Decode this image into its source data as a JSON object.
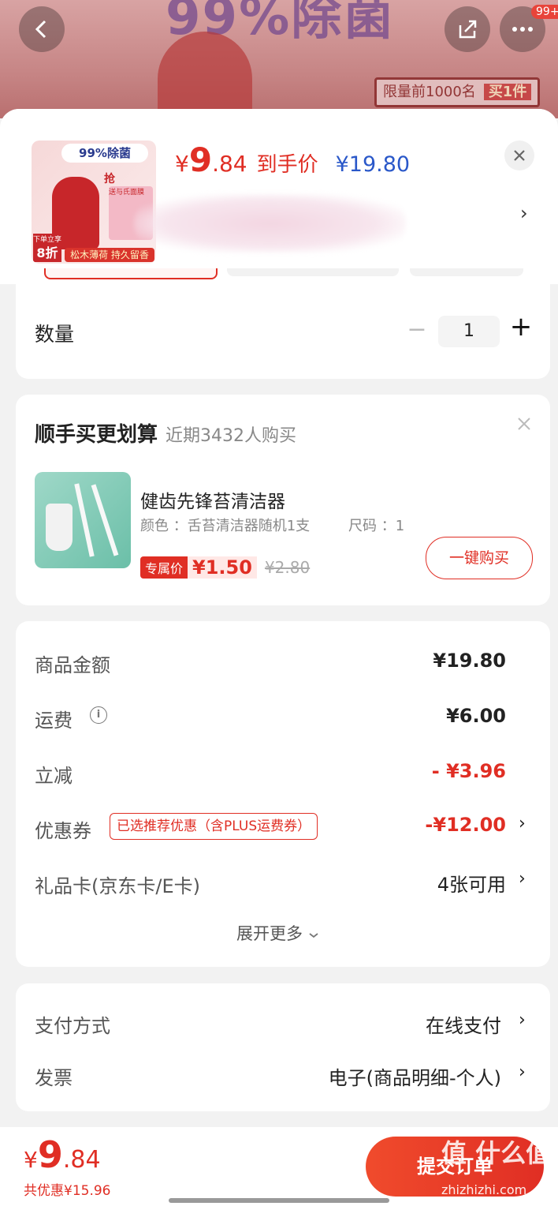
{
  "banner": {
    "big_text": "99%除菌",
    "strip_text": "限量前1000名",
    "strip_badge": "买1件",
    "back_icon": "chevron-left-icon",
    "share_icon": "share-icon",
    "more_icon": "more-icon",
    "badge": "99+"
  },
  "product": {
    "thumb_top": "99%除菌",
    "thumb_grab": "抢",
    "thumb_gift": "送与氏面膜",
    "thumb_discount": "8折",
    "thumb_discount_pre": "下单立享",
    "thumb_slogan": "松木薄荷 持久留香",
    "price_symbol": "¥",
    "price_int": "9",
    "price_dec": ".84",
    "price_tag": "到手价",
    "orig_price": "¥19.80"
  },
  "quantity": {
    "label": "数量",
    "minus": "−",
    "value": "1",
    "plus": "+"
  },
  "addon": {
    "title": "顺手买更划算",
    "subtitle": "近期3432人购买",
    "item_name": "健齿先锋苔清洁器",
    "item_color": "颜色 ：舌苔清洁器随机1支",
    "item_size": "尺码 ：1",
    "tag": "专属价",
    "price": "¥1.50",
    "orig_price": "¥2.80",
    "buy_button": "一键购买"
  },
  "summary": {
    "rows": [
      {
        "label": "商品金额",
        "value": "¥19.80"
      },
      {
        "label": "运费",
        "value": "¥6.00"
      },
      {
        "label": "立减",
        "value": "- ¥3.96"
      },
      {
        "label": "优惠券",
        "tag": "已选推荐优惠（含PLUS运费券）",
        "value": "-¥12.00"
      },
      {
        "label": "礼品卡(京东卡/E卡)",
        "value": "4张可用"
      }
    ],
    "expand": "展开更多"
  },
  "payment": {
    "method_label": "支付方式",
    "method_value": "在线支付",
    "invoice_label": "发票",
    "invoice_value": "电子(商品明细-个人)"
  },
  "footer": {
    "symbol": "¥",
    "total_int": "9",
    "total_dec": ".84",
    "discount": "共优惠¥15.96",
    "submit": "提交订单",
    "watermark": "值 什么值得买",
    "watermark_url": "zhizhizhi.com"
  },
  "colors": {
    "accent": "#e02e24",
    "price_blue": "#2a58c9"
  }
}
